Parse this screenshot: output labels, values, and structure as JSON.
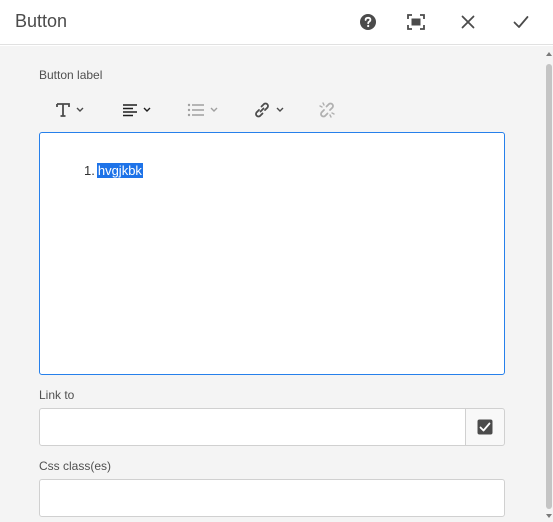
{
  "dialog": {
    "title": "Button",
    "help_icon": "help-circle-icon",
    "fullscreen_icon": "fullscreen-icon",
    "close_icon": "close-icon",
    "done_icon": "checkmark-icon"
  },
  "form": {
    "button_label": "Button label",
    "link_to_label": "Link to",
    "css_class_label": "Css class(es)",
    "link_to_value": "",
    "css_class_value": ""
  },
  "toolbar": {
    "items": [
      {
        "icon": "text-format-icon"
      },
      {
        "icon": "align-left-icon"
      },
      {
        "icon": "list-icon"
      },
      {
        "icon": "link-icon"
      },
      {
        "icon": "unlink-icon"
      }
    ]
  },
  "editor": {
    "list_number": "1.",
    "selected_text": "hvgjkbk"
  },
  "colors": {
    "accent": "#2680eb",
    "selection": "#1e73e8",
    "panel_bg": "#f4f4f4"
  }
}
